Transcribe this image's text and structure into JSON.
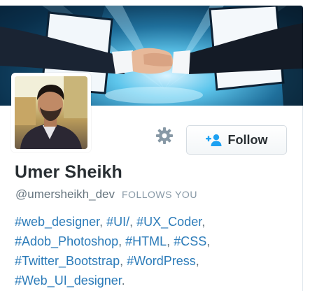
{
  "profile": {
    "name": "Umer Sheikh",
    "handle": "@umersheikh_dev",
    "follows_you": "FOLLOWS YOU",
    "follow_label": "Follow",
    "bio": {
      "lines": [
        [
          {
            "tag": "#web_designer"
          },
          {
            "text": ", "
          },
          {
            "tag": "#UI/"
          },
          {
            "text": ", "
          },
          {
            "tag": "#UX_Coder"
          },
          {
            "text": ","
          }
        ],
        [
          {
            "tag": "#Adob_Photoshop"
          },
          {
            "text": ", "
          },
          {
            "tag": "#HTML"
          },
          {
            "text": ", "
          },
          {
            "tag": "#CSS"
          },
          {
            "text": ","
          }
        ],
        [
          {
            "tag": "#Twitter_Bootstrap"
          },
          {
            "text": ", "
          },
          {
            "tag": "#WordPress"
          },
          {
            "text": ","
          }
        ],
        [
          {
            "tag": "#Web_UI_designer"
          },
          {
            "text": "."
          }
        ]
      ]
    }
  },
  "icons": {
    "settings": "gear-icon",
    "follow": "add-user-icon"
  },
  "colors": {
    "link": "#2b7bb9",
    "name": "#292f33",
    "muted": "#66757f",
    "follow_icon": "#1da1f2"
  }
}
